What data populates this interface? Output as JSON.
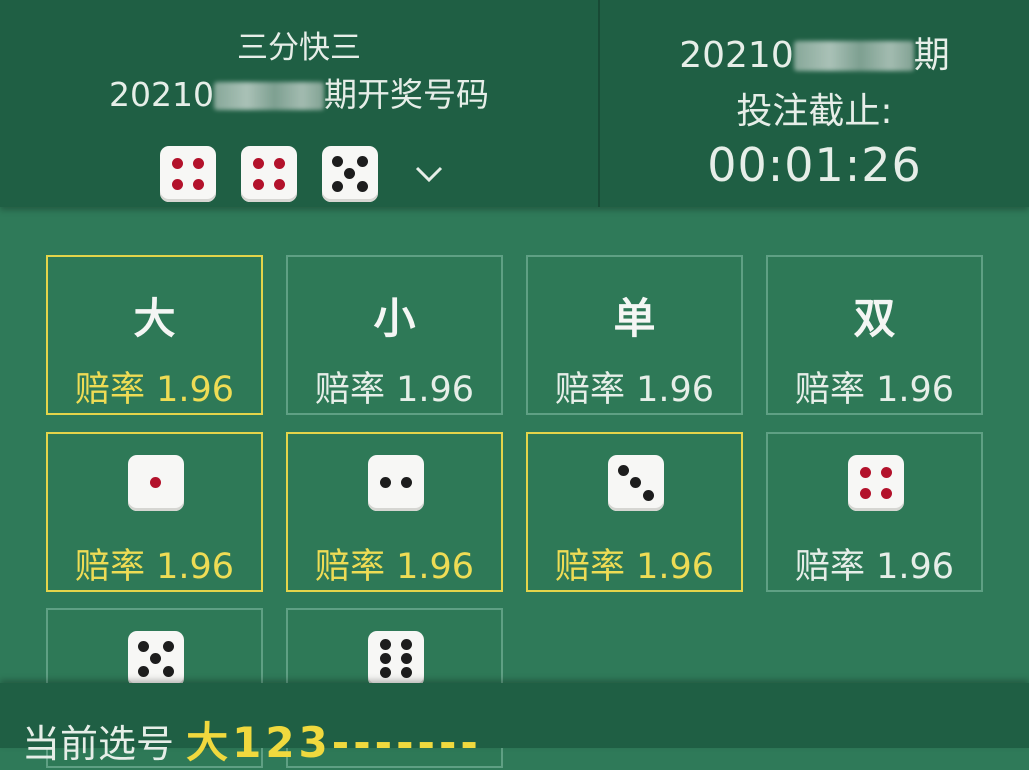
{
  "header": {
    "game_name": "三分快三",
    "issue_prefix": "20210",
    "issue_suffix": "期开奖号码",
    "result_dice": [
      4,
      4,
      5
    ],
    "expand_icon": "chevron-down-icon"
  },
  "countdown_panel": {
    "issue_prefix": "20210",
    "issue_suffix": "期",
    "deadline_label": "投注截止:",
    "time": "00:01:26"
  },
  "bet_options": {
    "odds_label": "赔率 1.96",
    "text_cells": [
      {
        "label": "大",
        "selected": true
      },
      {
        "label": "小",
        "selected": false
      },
      {
        "label": "单",
        "selected": false
      },
      {
        "label": "双",
        "selected": false
      }
    ],
    "dice_cells": [
      {
        "face": 1,
        "selected": true
      },
      {
        "face": 2,
        "selected": true
      },
      {
        "face": 3,
        "selected": true
      },
      {
        "face": 4,
        "selected": false
      },
      {
        "face": 5,
        "selected": false
      },
      {
        "face": 6,
        "selected": false
      }
    ]
  },
  "footer": {
    "current_label": "当前选号",
    "current_value": "大123-------"
  },
  "colors": {
    "background": "#2f7a59",
    "header": "#1f5f44",
    "selected_border": "#e4d44a",
    "die_red_pip": "#b3122b"
  }
}
